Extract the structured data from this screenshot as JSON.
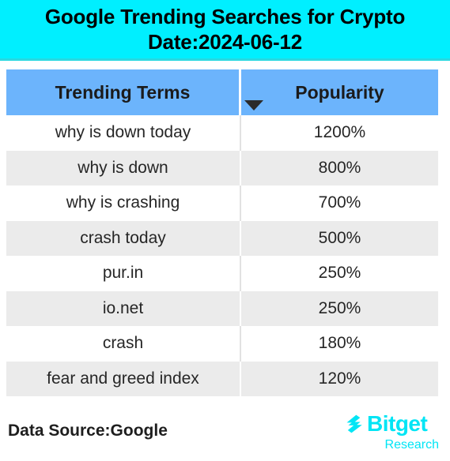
{
  "title": {
    "line1": "Google Trending Searches for Crypto",
    "line2": "Date:2024-06-12"
  },
  "colors": {
    "banner_bg": "#00EFFF",
    "header_row_bg": "#6CB4FC",
    "alt_row_bg": "#EBEBEB",
    "brand": "#00E5F5"
  },
  "table": {
    "columns": [
      "Trending Terms",
      "Popularity"
    ],
    "sort_indicator": "chevron-down",
    "rows": [
      {
        "term": "why is down today",
        "popularity": "1200%"
      },
      {
        "term": "why is down",
        "popularity": "800%"
      },
      {
        "term": "why is crashing",
        "popularity": "700%"
      },
      {
        "term": "crash today",
        "popularity": "500%"
      },
      {
        "term": "pur.in",
        "popularity": "250%"
      },
      {
        "term": "io.net",
        "popularity": "250%"
      },
      {
        "term": "crash",
        "popularity": "180%"
      },
      {
        "term": "fear and greed index",
        "popularity": "120%"
      }
    ]
  },
  "footer": {
    "data_source": "Data Source:Google",
    "logo_word": "Bitget",
    "logo_sub": "Research"
  },
  "chart_data": {
    "type": "table",
    "title": "Google Trending Searches for Crypto",
    "subtitle": "Date:2024-06-12",
    "columns": [
      "Trending Terms",
      "Popularity"
    ],
    "categories": [
      "why is down today",
      "why is down",
      "why is crashing",
      "crash today",
      "pur.in",
      "io.net",
      "crash",
      "fear and greed index"
    ],
    "values": [
      1200,
      800,
      700,
      500,
      250,
      250,
      180,
      120
    ],
    "value_unit": "%",
    "xlabel": "Trending Terms",
    "ylabel": "Popularity",
    "source": "Google"
  }
}
